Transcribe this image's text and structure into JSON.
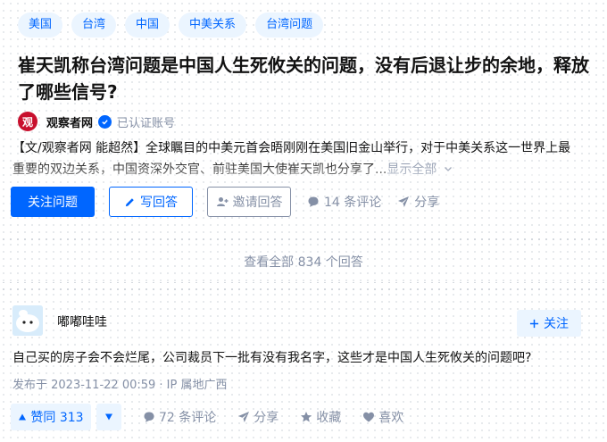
{
  "tags": [
    "美国",
    "台湾",
    "中国",
    "中美关系",
    "台湾问题"
  ],
  "question": {
    "title": "崔天凯称台湾问题是中国人生死攸关的问题，没有后退让步的余地，释放了哪些信号?"
  },
  "author": {
    "logo_text": "观",
    "name": "观察者网",
    "verified_text": "已认证账号"
  },
  "excerpt": {
    "line1": "【文/观察者网 能超然】全球瞩目的中美元首会晤刚刚在美国旧金山举行，对于中美关系这一世界上最",
    "line2": "重要的双边关系，中国资深外交官、前驻美国大使崔天凯也分享了...",
    "show_all": "显示全部"
  },
  "actions": {
    "follow_question": "关注问题",
    "write_answer": "写回答",
    "invite_answer": "邀请回答",
    "comments": "14 条评论",
    "share": "分享"
  },
  "view_all_answers": "查看全部 834 个回答",
  "answer": {
    "author_name": "嘟嘟哇哇",
    "follow_label": "关注",
    "text": "自己买的房子会不会烂尾，公司裁员下一批有没有我名字，这些才是中国人生死攸关的问题吧?",
    "meta": "发布于 2023-11-22 00:59 · IP 属地广西",
    "upvote_label": "赞同 313",
    "comments": "72 条评论",
    "share": "分享",
    "collect": "收藏",
    "like": "喜欢"
  },
  "colors": {
    "brand_blue": "#0066ff",
    "tag_bg": "#ebf5ff",
    "muted_gray": "#8590a6"
  }
}
